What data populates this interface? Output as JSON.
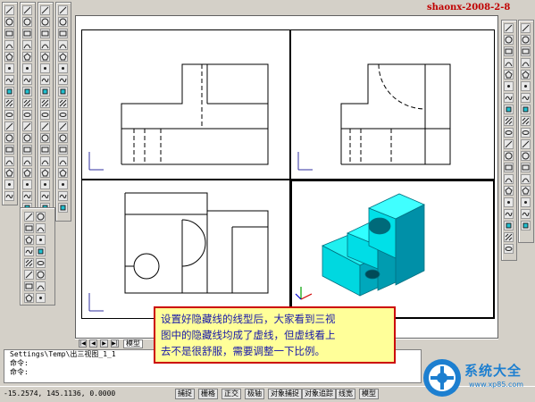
{
  "watermark": "shaonx-2008-2-8",
  "tabs": {
    "model_label": "模型",
    "nav": [
      "|◀",
      "◀",
      "▶",
      "▶|"
    ]
  },
  "command": {
    "lines": [
      "Settings\\Temp\\出三视图_1_1",
      "命令:",
      "命令:"
    ]
  },
  "status": {
    "coords": "-15.2574, 145.1136, 0.0000",
    "buttons": [
      "捕捉",
      "栅格",
      "正交",
      "极轴",
      "对象捕捉",
      "对象追踪",
      "线宽",
      "模型"
    ]
  },
  "callout": {
    "lines": [
      "设置好隐藏线的线型后，大家看到三视",
      "图中的隐藏线均成了虚线，但虚线看上",
      "去不是很舒服，需要调整一下比例。"
    ],
    "colors": {
      "text": "#1a1aa8",
      "border": "#cc0000",
      "fill": "#ffff99"
    }
  },
  "logo": {
    "name": "系统大全",
    "url": "www.xp85.com",
    "color": "#1d7fd0"
  },
  "colors": {
    "solid": "#00ffff",
    "solid_dark": "#00a6b8",
    "paper": "#ffffff",
    "chrome": "#d4d0c8"
  }
}
